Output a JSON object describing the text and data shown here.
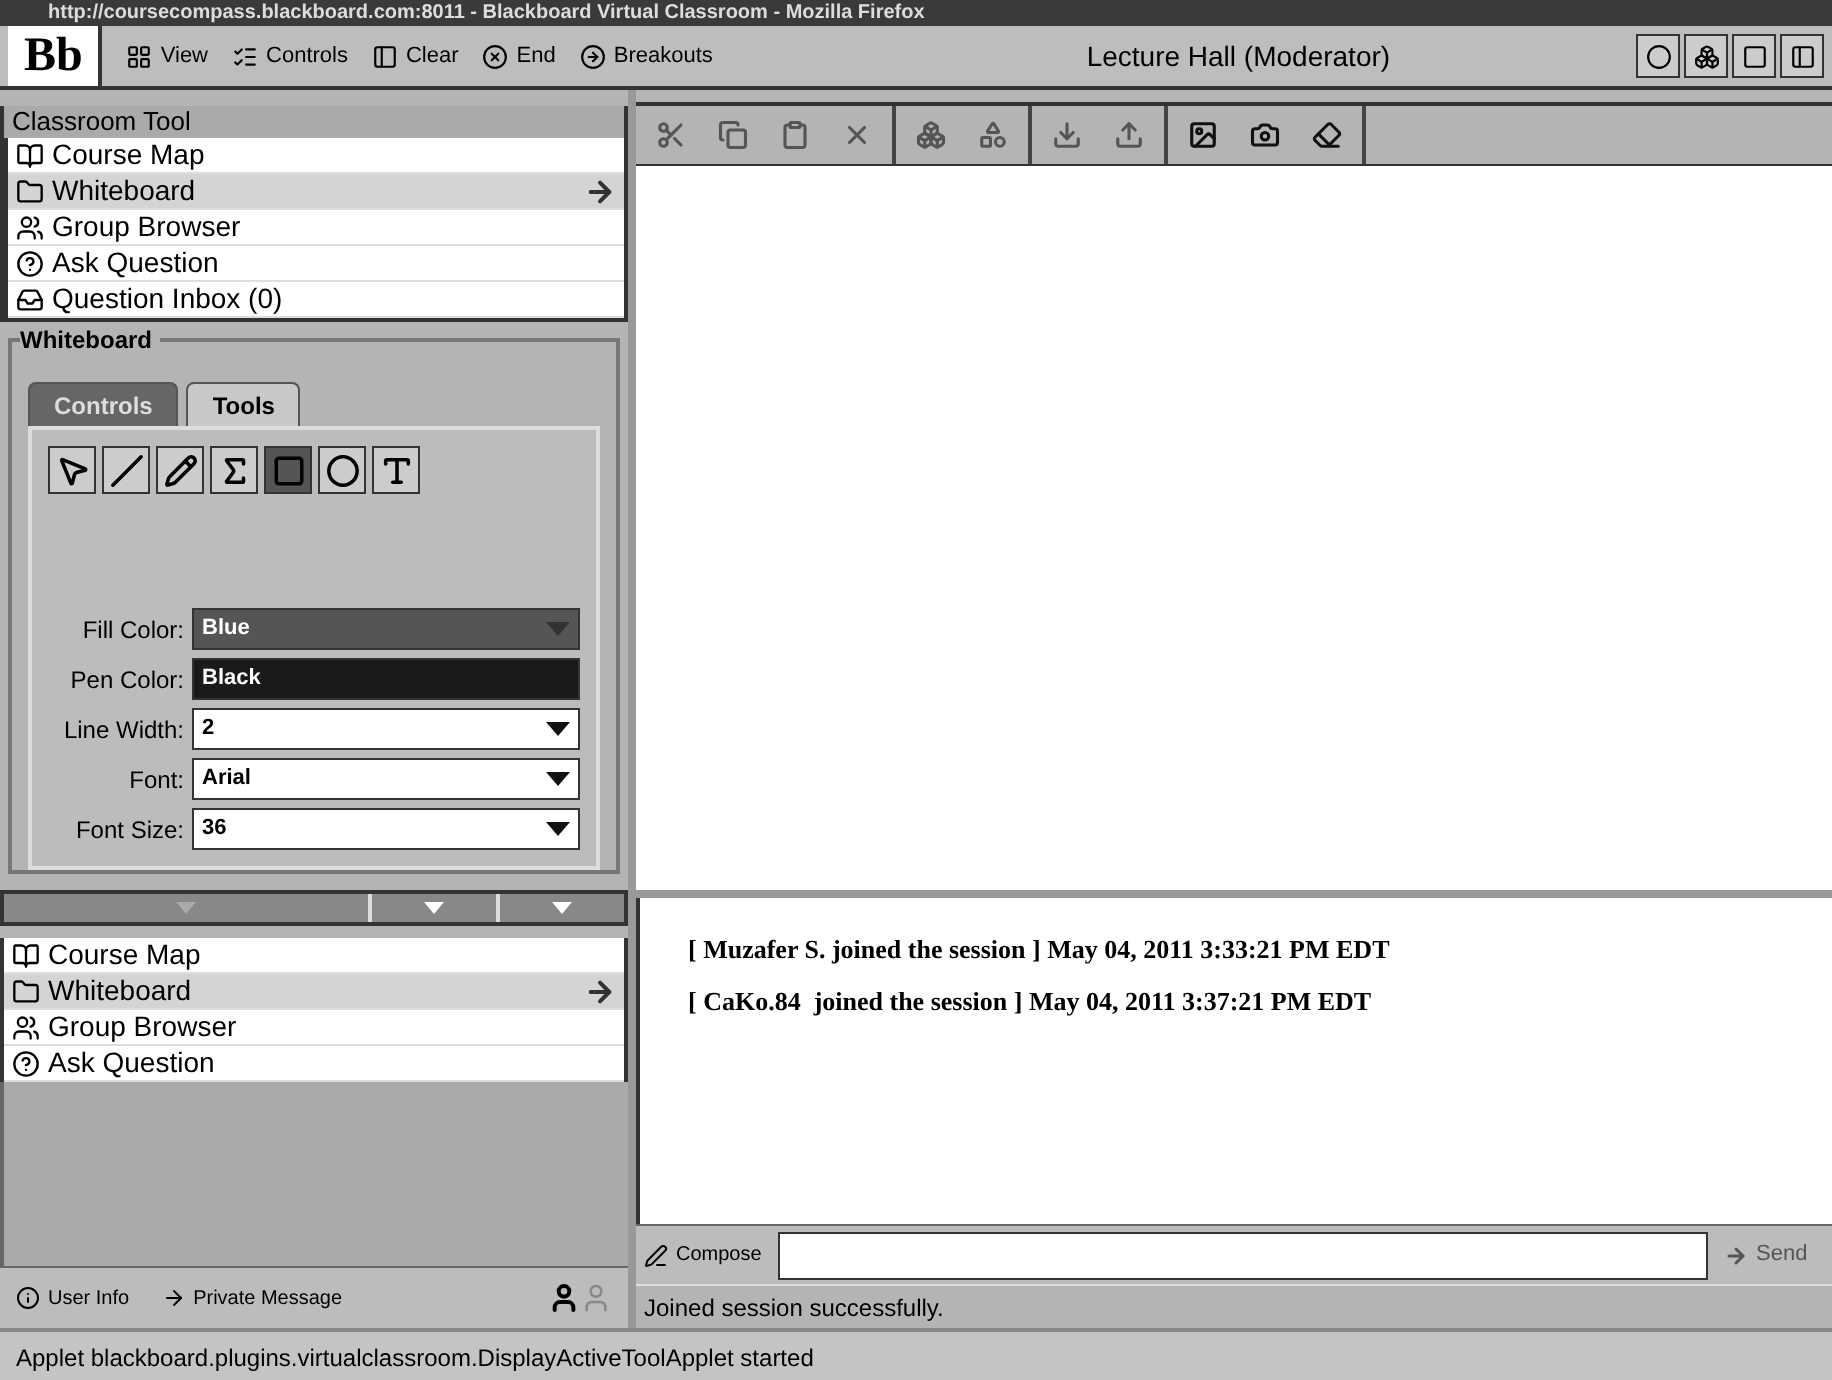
{
  "window": {
    "title": "http://coursecompass.blackboard.com:8011 - Blackboard Virtual Classroom - Mozilla Firefox"
  },
  "toolbar": {
    "logo": "Bb",
    "buttons": [
      {
        "kind": "view",
        "label": "View"
      },
      {
        "kind": "controls",
        "label": "Controls"
      },
      {
        "kind": "clear",
        "label": "Clear"
      },
      {
        "kind": "end",
        "label": "End"
      },
      {
        "kind": "breakouts",
        "label": "Breakouts"
      }
    ],
    "room": "Lecture Hall (Moderator)"
  },
  "classroom_tool": {
    "title": "Classroom Tool",
    "items": [
      {
        "kind": "map",
        "label": "Course Map",
        "selected": false
      },
      {
        "kind": "board",
        "label": "Whiteboard",
        "selected": true
      },
      {
        "kind": "group",
        "label": "Group Browser",
        "selected": false
      },
      {
        "kind": "question",
        "label": "Ask Question",
        "selected": false
      },
      {
        "kind": "inbox",
        "label": "Question Inbox (0)",
        "selected": false
      }
    ]
  },
  "whiteboard": {
    "title": "Whiteboard",
    "tabs": [
      {
        "label": "Controls",
        "selected": false
      },
      {
        "label": "Tools",
        "selected": true
      }
    ],
    "tools": [
      {
        "kind": "pointer",
        "selected": false
      },
      {
        "kind": "line",
        "selected": false
      },
      {
        "kind": "pen",
        "selected": false
      },
      {
        "kind": "sigma",
        "selected": false
      },
      {
        "kind": "rect",
        "selected": true
      },
      {
        "kind": "circle",
        "selected": false
      },
      {
        "kind": "text",
        "selected": false
      }
    ],
    "fields": [
      {
        "kind": "dropdown",
        "label": "Fill Color:",
        "value": "Blue",
        "color": "#555555"
      },
      {
        "kind": "swatch",
        "label": "Pen Color:",
        "value": "Black",
        "color": "#1a1a1a"
      },
      {
        "kind": "dropdown",
        "label": "Line Width:",
        "value": "2"
      },
      {
        "kind": "dropdown",
        "label": "Font:",
        "value": "Arial"
      },
      {
        "kind": "dropdown",
        "label": "Font Size:",
        "value": "36"
      }
    ]
  },
  "participants": {
    "items": [
      {
        "kind": "map",
        "label": "Course Map",
        "selected": false
      },
      {
        "kind": "board",
        "label": "Whiteboard",
        "selected": true
      },
      {
        "kind": "group",
        "label": "Group Browser",
        "selected": false
      },
      {
        "kind": "question",
        "label": "Ask Question",
        "selected": false
      }
    ],
    "actions": [
      {
        "kind": "info",
        "label": "User Info"
      },
      {
        "kind": "message",
        "label": "Private Message"
      }
    ]
  },
  "chat": {
    "messages": [
      "[ Muzafer S. joined the session ] May 04, 2011 3:33:21 PM EDT",
      "[ CaKo.84  joined the session ] May 04, 2011 3:37:21 PM EDT"
    ],
    "compose": "Compose",
    "send": "Send",
    "status": "Joined session successfully."
  },
  "status_bar": "Applet blackboard.plugins.virtualclassroom.DisplayActiveToolApplet started"
}
